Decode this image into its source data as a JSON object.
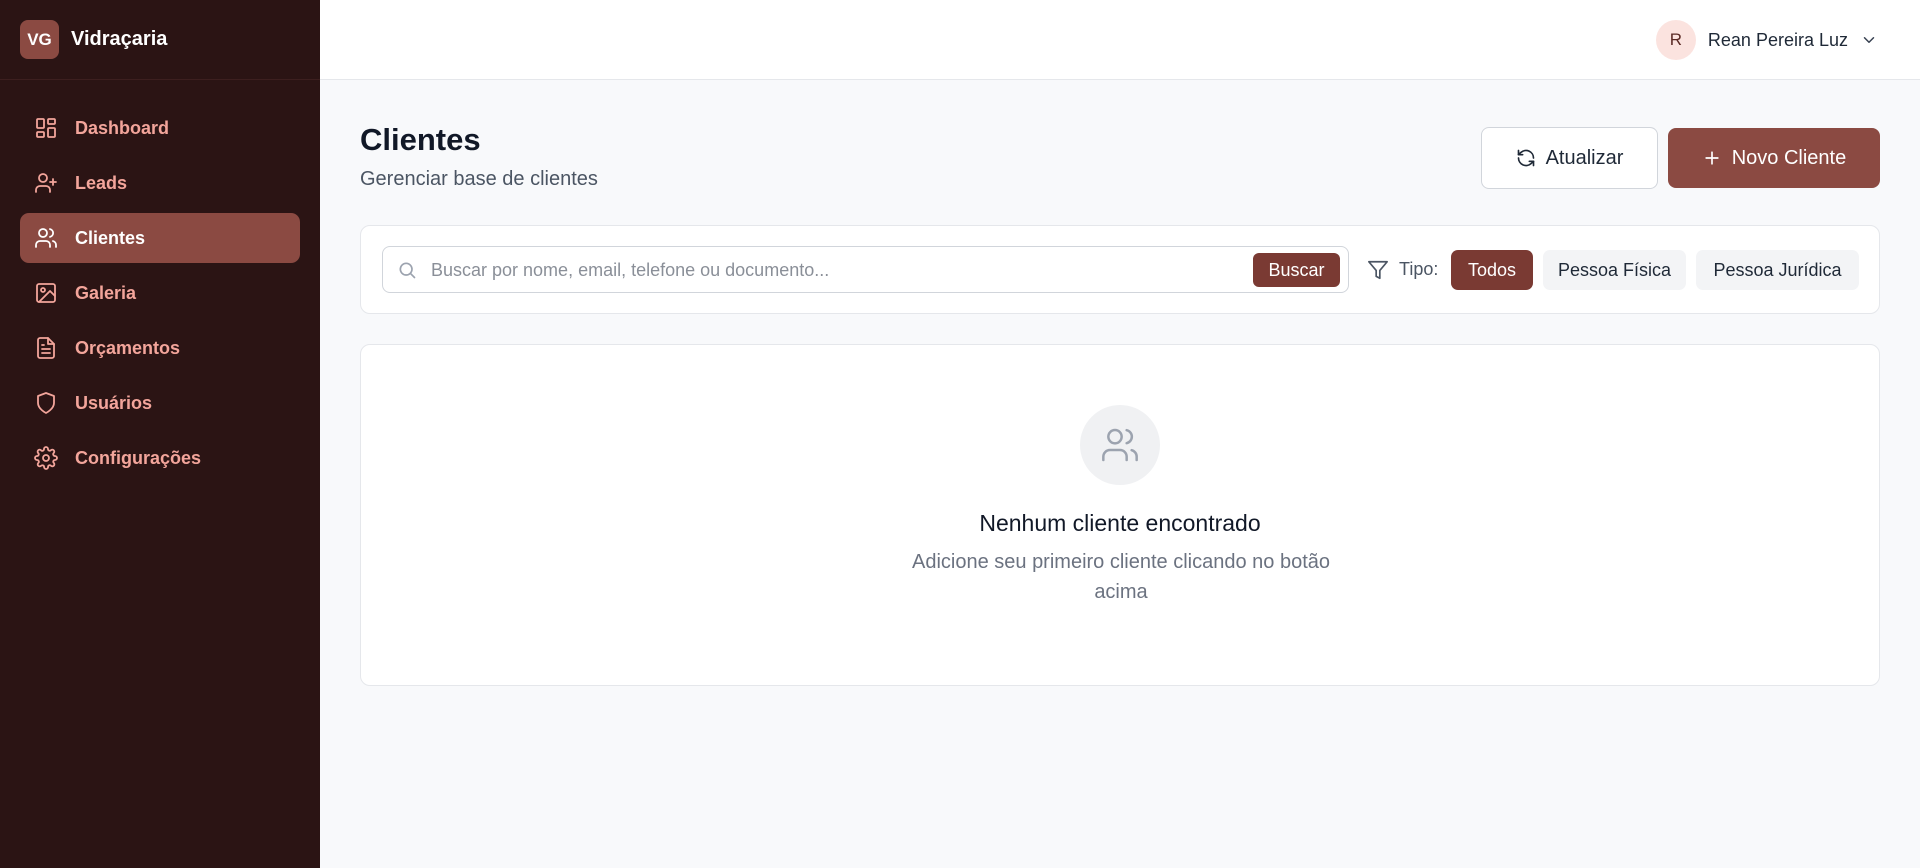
{
  "brand": {
    "logo": "VG",
    "name": "Vidraçaria"
  },
  "sidebar": {
    "items": [
      {
        "label": "Dashboard",
        "icon": "dashboard-icon",
        "active": false
      },
      {
        "label": "Leads",
        "icon": "user-plus-icon",
        "active": false
      },
      {
        "label": "Clientes",
        "icon": "users-icon",
        "active": true
      },
      {
        "label": "Galeria",
        "icon": "image-icon",
        "active": false
      },
      {
        "label": "Orçamentos",
        "icon": "file-text-icon",
        "active": false
      },
      {
        "label": "Usuários",
        "icon": "shield-icon",
        "active": false
      },
      {
        "label": "Configurações",
        "icon": "gear-icon",
        "active": false
      }
    ]
  },
  "user": {
    "initial": "R",
    "name": "Rean Pereira Luz"
  },
  "header": {
    "title": "Clientes",
    "subtitle": "Gerenciar base de clientes",
    "refresh_label": "Atualizar",
    "new_label": "Novo Cliente"
  },
  "search": {
    "placeholder": "Buscar por nome, email, telefone ou documento...",
    "value": "",
    "button_label": "Buscar"
  },
  "filter": {
    "label": "Tipo:",
    "options": [
      {
        "label": "Todos",
        "selected": true
      },
      {
        "label": "Pessoa Física",
        "selected": false
      },
      {
        "label": "Pessoa Jurídica",
        "selected": false
      }
    ]
  },
  "empty": {
    "title": "Nenhum cliente encontrado",
    "description": "Adicione seu primeiro cliente clicando no botão acima"
  },
  "colors": {
    "sidebar_bg": "#2b1414",
    "accent": "#8b4a42",
    "accent_dark": "#7a3a33",
    "nav_text": "#f3a59b"
  }
}
